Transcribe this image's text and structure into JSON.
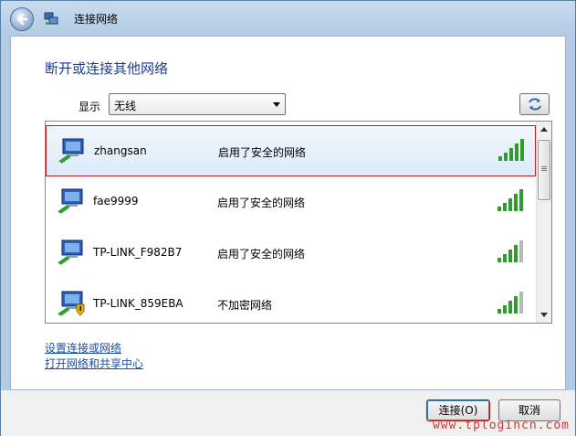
{
  "window": {
    "title": "连接网络"
  },
  "main": {
    "heading": "断开或连接其他网络",
    "show_label": "显示",
    "show_value": "无线"
  },
  "networks": [
    {
      "name": "zhangsan",
      "status": "启用了安全的网络",
      "signal_bars": 5,
      "secured": true,
      "selected": true
    },
    {
      "name": "fae9999",
      "status": "启用了安全的网络",
      "signal_bars": 5,
      "secured": true,
      "selected": false
    },
    {
      "name": "TP-LINK_F982B7",
      "status": "启用了安全的网络",
      "signal_bars": 4,
      "secured": true,
      "selected": false
    },
    {
      "name": "TP-LINK_859EBA",
      "status": "不加密网络",
      "signal_bars": 4,
      "secured": false,
      "selected": false
    }
  ],
  "links": {
    "setup": "设置连接或网络",
    "open_center": "打开网络和共享中心"
  },
  "buttons": {
    "connect": "连接(O)",
    "cancel": "取消"
  },
  "watermark": "www.tplogincn.com",
  "colors": {
    "heading": "#1e3f8a",
    "link": "#1a4fa0",
    "signal": "#2e9d2e",
    "selection_border": "#c41a1a"
  }
}
